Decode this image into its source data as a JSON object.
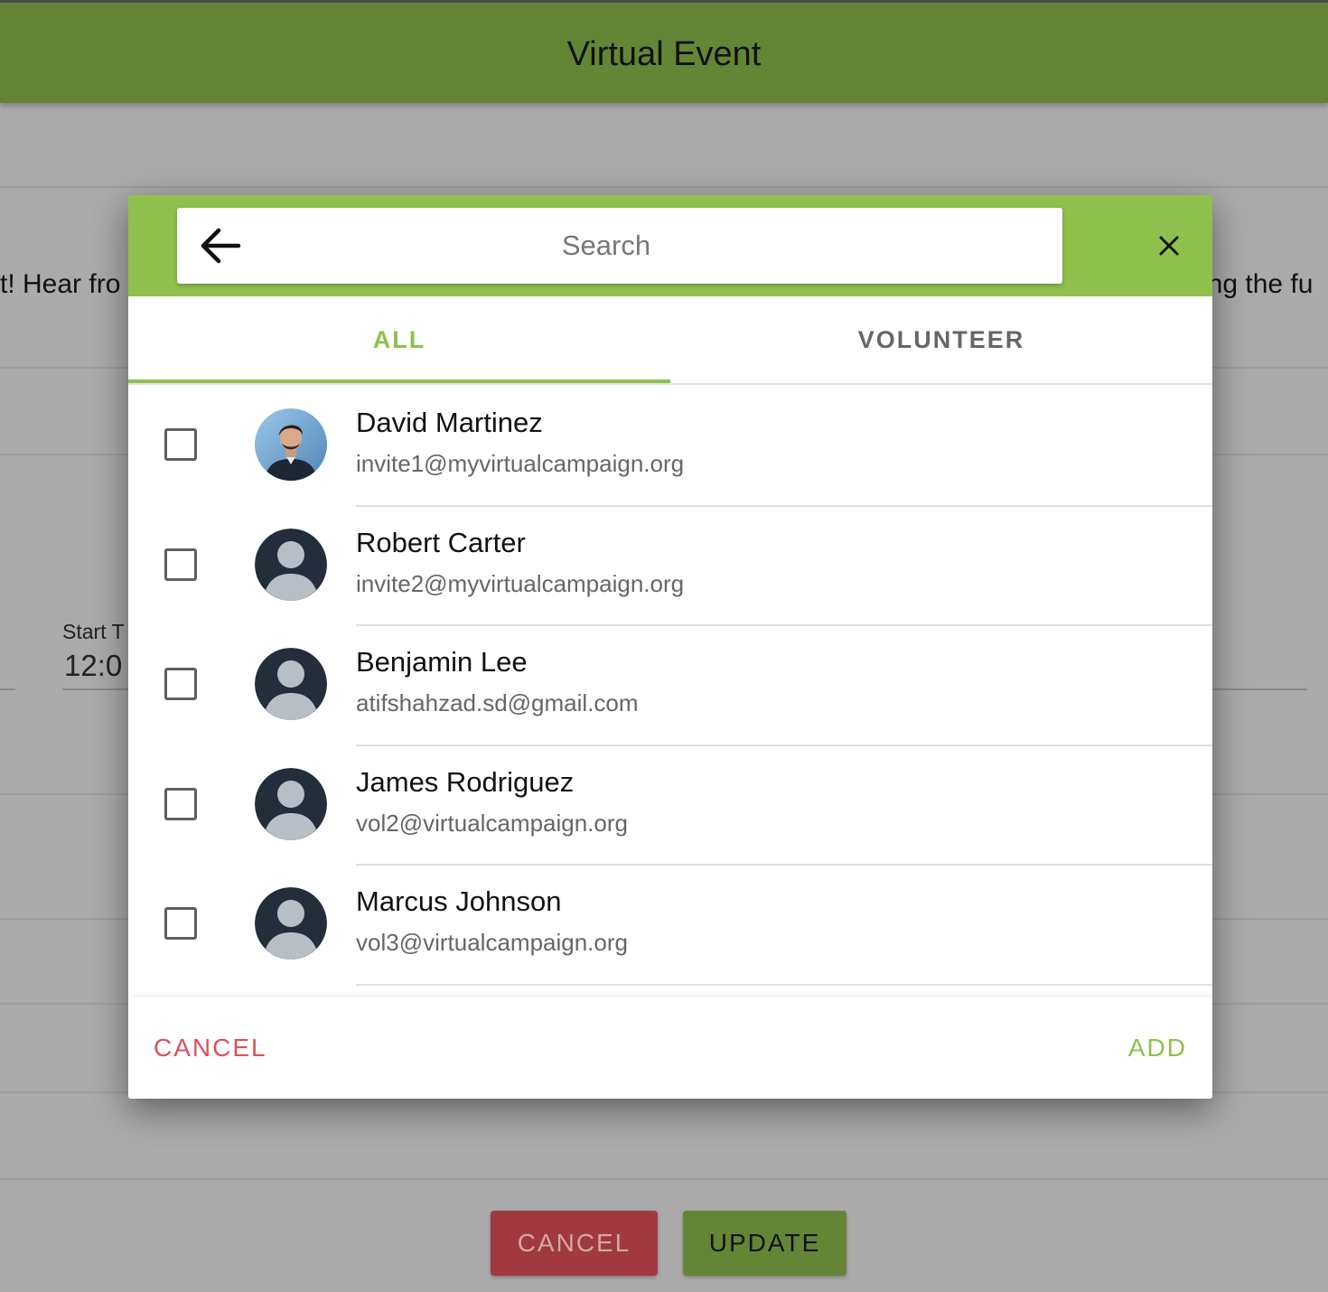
{
  "app": {
    "title": "Virtual Event"
  },
  "background": {
    "text_left": "t! Hear fro",
    "text_right": "ing the fu",
    "start_label": "Start T",
    "start_value": "12:0",
    "cancel_button": "CANCEL",
    "update_button": "UPDATE"
  },
  "dialog": {
    "search": {
      "placeholder": "Search",
      "value": ""
    },
    "tabs": [
      {
        "label": "ALL",
        "active": true
      },
      {
        "label": "VOLUNTEER",
        "active": false
      }
    ],
    "contacts": [
      {
        "name": "David Martinez",
        "email": "invite1@myvirtualcampaign.org",
        "avatar": "photo",
        "checked": false
      },
      {
        "name": "Robert Carter",
        "email": "invite2@myvirtualcampaign.org",
        "avatar": "default-person-icon",
        "checked": false
      },
      {
        "name": "Benjamin Lee",
        "email": "atifshahzad.sd@gmail.com",
        "avatar": "default-person-icon",
        "checked": false
      },
      {
        "name": "James Rodriguez",
        "email": "vol2@virtualcampaign.org",
        "avatar": "default-person-icon",
        "checked": false
      },
      {
        "name": "Marcus Johnson",
        "email": "vol3@virtualcampaign.org",
        "avatar": "default-person-icon",
        "checked": false
      }
    ],
    "cancel_label": "CANCEL",
    "add_label": "ADD"
  },
  "colors": {
    "app_bar": "#658536",
    "dialog_header": "#8fc04d",
    "accent_green": "#8fc04d",
    "cancel_red": "#d9525c",
    "avatar_dark": "#232d3b"
  }
}
